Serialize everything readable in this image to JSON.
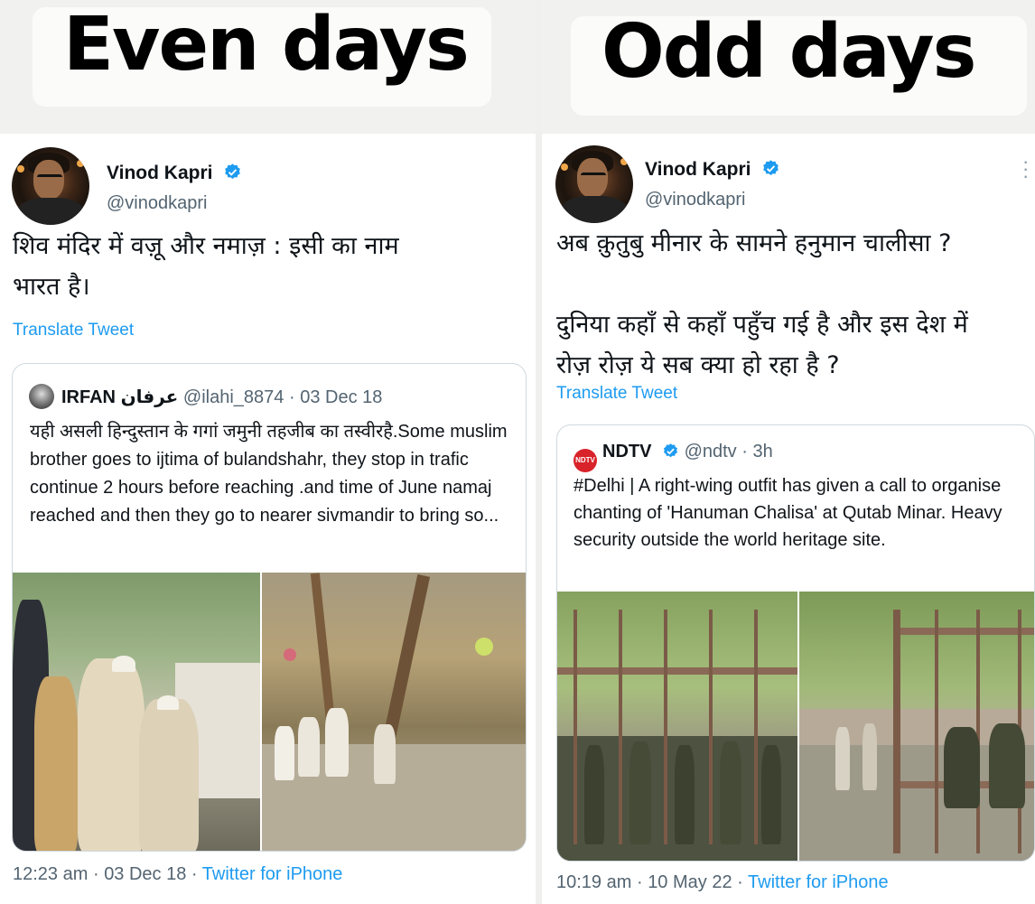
{
  "panels": {
    "left": {
      "heading": "Even days",
      "author": {
        "name": "Vinod Kapri",
        "handle": "@vinodkapri"
      },
      "text": "शिव मंदिर में वज़ू और नमाज़ : इसी का नाम\nभारत है।",
      "translate_label": "Translate Tweet",
      "quote": {
        "name": "IRFAN",
        "name_extra": "عرفان",
        "handle": "@ilahi_8874",
        "separator": "·",
        "date": "03 Dec 18",
        "text": "यही असली हिन्दुस्तान के गगां जमुनी तहजीब का तस्वीरहै.Some muslim brother goes to ijtima of bulandshahr,  they stop in trafic continue 2 hours before reaching .and time of June namaj reached and then they go to nearer sivmandir to bring so..."
      },
      "footer": {
        "time": "12:23 am",
        "separator": "·",
        "date": "03 Dec 18",
        "separator2": "·",
        "source": "Twitter for iPhone"
      }
    },
    "right": {
      "heading": "Odd days",
      "author": {
        "name": "Vinod Kapri",
        "handle": "@vinodkapri"
      },
      "text": "अब क़ुतुबु मीनार के सामने हनुमान चालीसा ?\n\nदुनिया कहाँ से कहाँ पहुँच गई है और इस देश में\nरोज़ रोज़ ये सब क्या हो रहा है  ?",
      "translate_label": "Translate Tweet",
      "quote": {
        "name": "NDTV",
        "logo_text": "NDTV",
        "handle": "@ndtv",
        "separator": "·",
        "date": "3h",
        "text": "#Delhi | A right-wing outfit has given a call to organise chanting of 'Hanuman Chalisa' at Qutab Minar. Heavy security outside the world heritage site."
      },
      "footer": {
        "time": "10:19 am",
        "separator": "·",
        "date": "10 May 22",
        "separator2": "·",
        "source": "Twitter for iPhone"
      }
    }
  },
  "colors": {
    "link": "#1d9bf0",
    "verified": "#1d9bf0",
    "muted": "#536471",
    "ndtv": "#d8232a"
  },
  "icons": [
    "verified-badge-icon",
    "more-options-icon"
  ]
}
